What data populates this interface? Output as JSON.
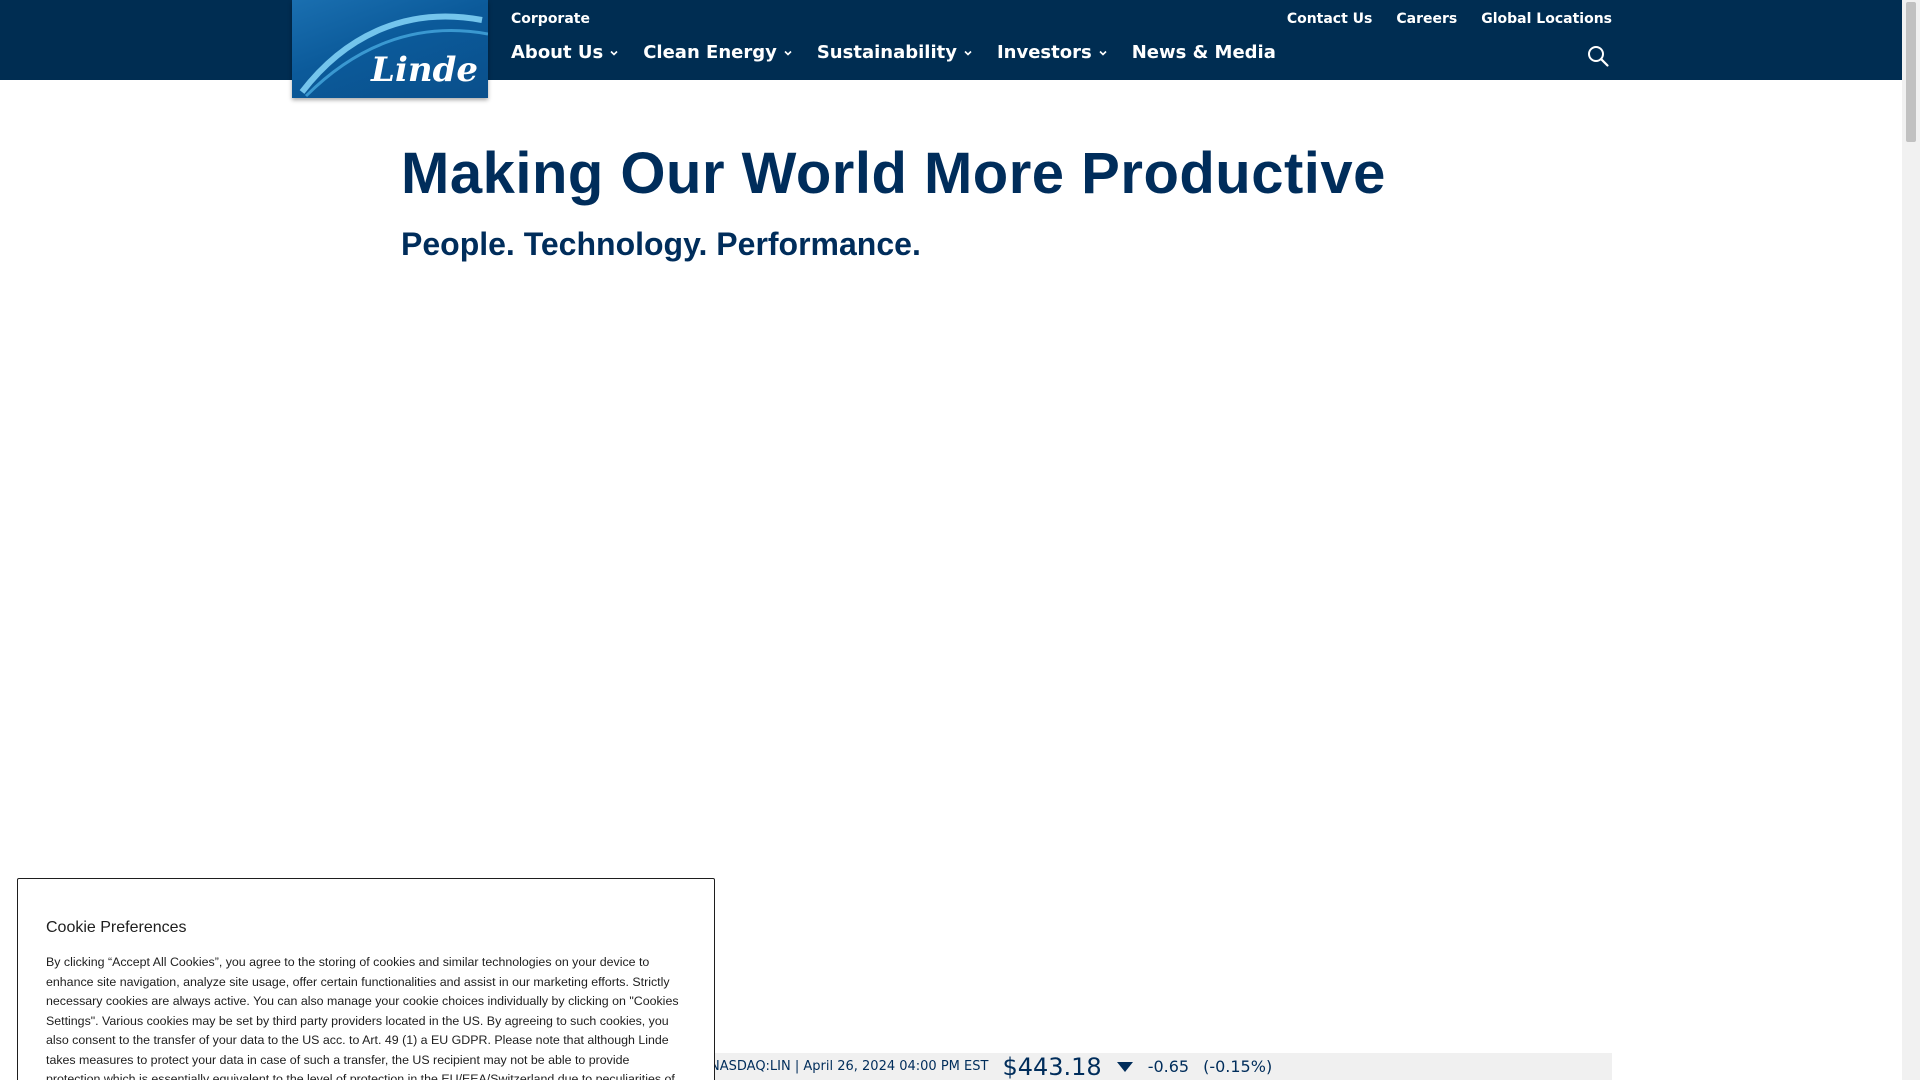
{
  "header": {
    "logo_text": "Linde",
    "corporate_label": "Corporate",
    "main_nav": [
      {
        "label": "About Us"
      },
      {
        "label": "Clean Energy"
      },
      {
        "label": "Sustainability"
      },
      {
        "label": "Investors"
      },
      {
        "label": "News & Media"
      }
    ],
    "utility_nav": [
      {
        "label": "Contact Us"
      },
      {
        "label": "Careers"
      },
      {
        "label": "Global Locations"
      }
    ],
    "search_icon": "search-icon"
  },
  "hero": {
    "title": "Making Our World More Productive",
    "subtitle": "People. Technology. Performance."
  },
  "stock": {
    "meta": "NASDAQ:LIN | April 26, 2024 04:00 PM EST",
    "price": "$443.18",
    "change": "-0.65",
    "change_pct": "(-0.15%)",
    "direction_icon": "caret-down-icon"
  },
  "cookie": {
    "title": "Cookie Preferences",
    "text": "By clicking “Accept All Cookies”, you agree to the storing of cookies and similar technologies on your device to enhance site navigation, analyze site usage, offer certain functionalities and assist in our marketing efforts. Strictly necessary cookies are always active. You can also manage your cookie choices individually by clicking on \"Cookies Settings\". Various cookies may be set by third party providers located in the US. By agreeing to such cookies, you also consent to the transfer of your data to the US acc. to Art. 49 (1) a EU GDPR. Please note that although Linde takes measures to protect your data in case of such a transfer, the US recipient may not be able to provide protection which is essentially equivalent to the level of protection in the EU/EEA/Switzerland due to peculiarities of US law. In"
  },
  "colors": {
    "nav_bg": "#002d52",
    "brand_blue": "#0b5a9a",
    "text_navy": "#002d5b"
  }
}
